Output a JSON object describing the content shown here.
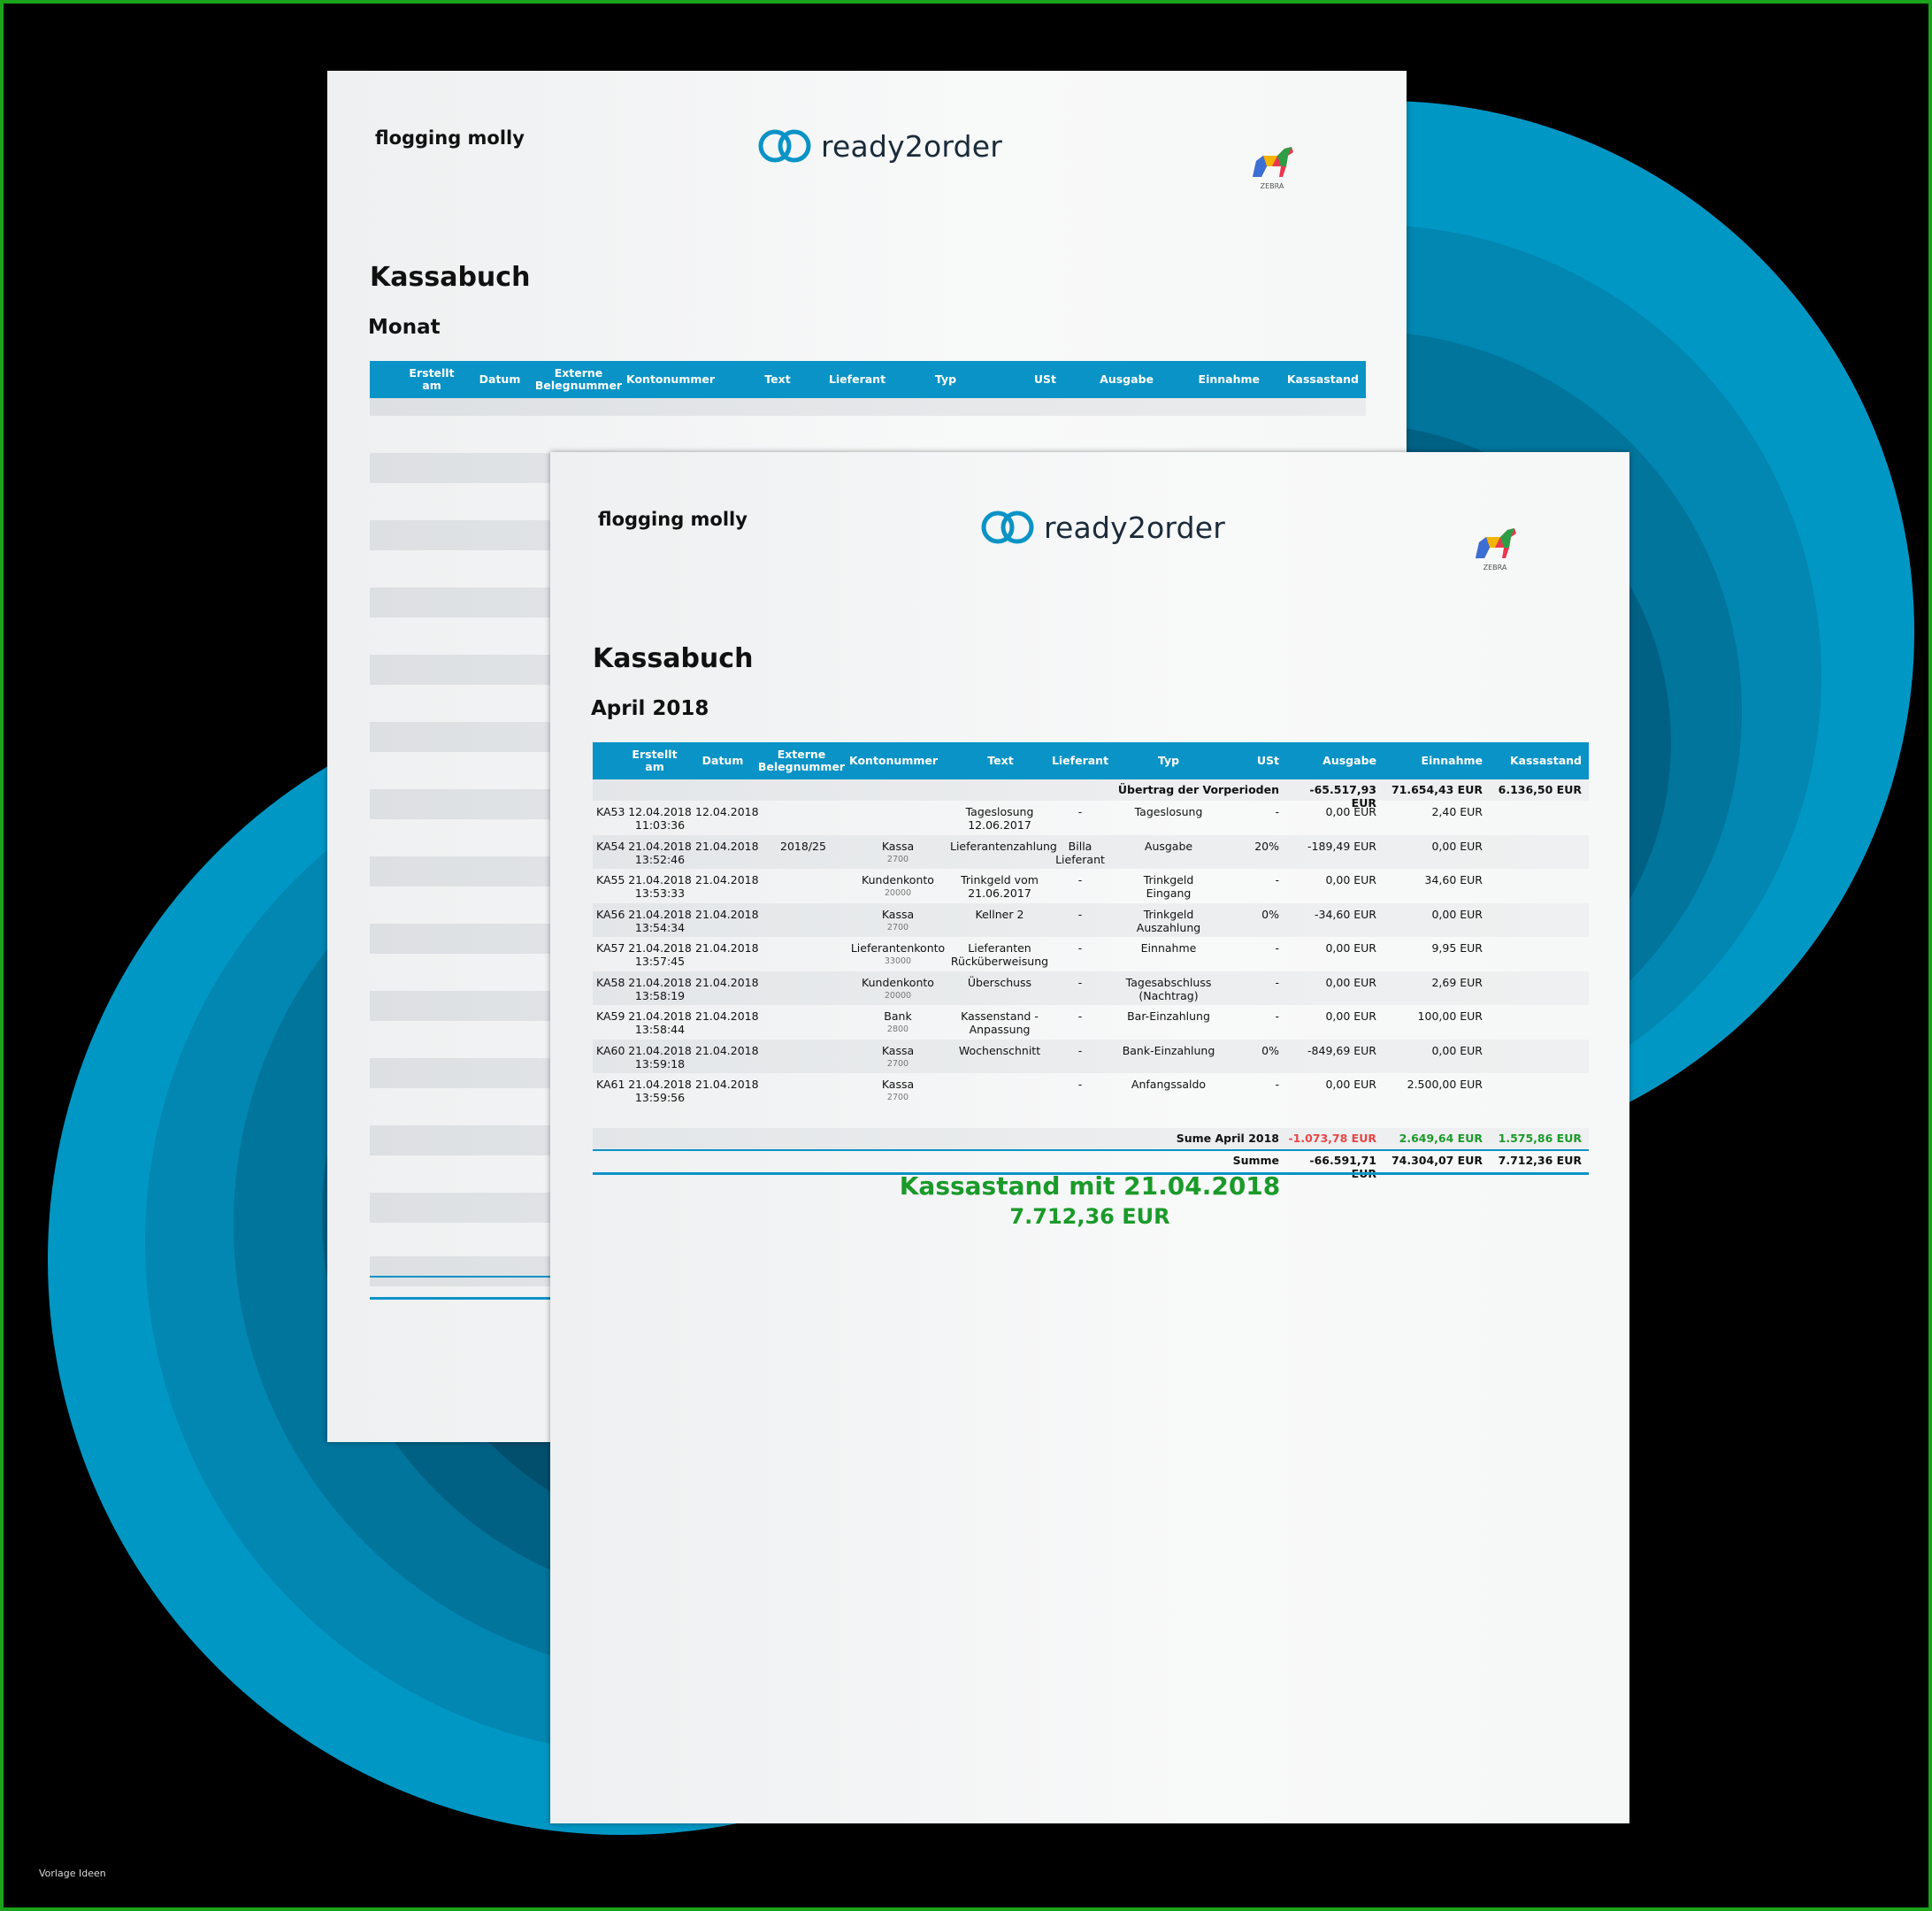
{
  "colors": {
    "accent": "#0a93c6",
    "green": "#1a9a2a",
    "red": "#e84545",
    "frame": "#1aa31a"
  },
  "brand": {
    "name": "ready2order",
    "logo_icon": "ready2order-rings-icon",
    "zebra_label": "ZEBRA"
  },
  "company": "flogging molly",
  "title": "Kassabuch",
  "back_page": {
    "period": "Monat"
  },
  "front_page": {
    "period": "April 2018"
  },
  "columns": {
    "erstellt": "Erstellt am",
    "datum": "Datum",
    "beleg": "Externe Belegnummer",
    "konto": "Kontonummer",
    "text": "Text",
    "lieferant": "Lieferant",
    "typ": "Typ",
    "ust": "USt",
    "ausgabe": "Ausgabe",
    "einnahme": "Einnahme",
    "kassastand": "Kassastand"
  },
  "carryover": {
    "label": "Übertrag der Vorperioden",
    "ausgabe": "-65.517,93 EUR",
    "einnahme": "71.654,43 EUR",
    "kassastand": "6.136,50 EUR"
  },
  "rows": [
    {
      "id": "KA53",
      "created_date": "12.04.2018",
      "created_time": "11:03:36",
      "datum": "12.04.2018",
      "beleg": "",
      "konto": "",
      "konto_nr": "",
      "text": "Tageslosung 12.06.2017",
      "lieferant": "-",
      "typ": "Tageslosung",
      "ust": "-",
      "ausgabe": "0,00 EUR",
      "einnahme": "2,40 EUR"
    },
    {
      "id": "KA54",
      "created_date": "21.04.2018",
      "created_time": "13:52:46",
      "datum": "21.04.2018",
      "beleg": "2018/25",
      "konto": "Kassa",
      "konto_nr": "2700",
      "text": "Lieferantenzahlung",
      "lieferant": "Billa Lieferant",
      "typ": "Ausgabe",
      "ust": "20%",
      "ausgabe": "-189,49 EUR",
      "einnahme": "0,00 EUR"
    },
    {
      "id": "KA55",
      "created_date": "21.04.2018",
      "created_time": "13:53:33",
      "datum": "21.04.2018",
      "beleg": "",
      "konto": "Kundenkonto",
      "konto_nr": "20000",
      "text": "Trinkgeld vom 21.06.2017",
      "lieferant": "-",
      "typ": "Trinkgeld Eingang",
      "ust": "-",
      "ausgabe": "0,00 EUR",
      "einnahme": "34,60 EUR"
    },
    {
      "id": "KA56",
      "created_date": "21.04.2018",
      "created_time": "13:54:34",
      "datum": "21.04.2018",
      "beleg": "",
      "konto": "Kassa",
      "konto_nr": "2700",
      "text": "Kellner 2",
      "lieferant": "-",
      "typ": "Trinkgeld Auszahlung",
      "ust": "0%",
      "ausgabe": "-34,60 EUR",
      "einnahme": "0,00 EUR"
    },
    {
      "id": "KA57",
      "created_date": "21.04.2018",
      "created_time": "13:57:45",
      "datum": "21.04.2018",
      "beleg": "",
      "konto": "Lieferantenkonto",
      "konto_nr": "33000",
      "text": "Lieferanten Rücküberweisung",
      "lieferant": "-",
      "typ": "Einnahme",
      "ust": "-",
      "ausgabe": "0,00 EUR",
      "einnahme": "9,95 EUR"
    },
    {
      "id": "KA58",
      "created_date": "21.04.2018",
      "created_time": "13:58:19",
      "datum": "21.04.2018",
      "beleg": "",
      "konto": "Kundenkonto",
      "konto_nr": "20000",
      "text": "Überschuss",
      "lieferant": "-",
      "typ": "Tagesabschluss (Nachtrag)",
      "ust": "-",
      "ausgabe": "0,00 EUR",
      "einnahme": "2,69 EUR"
    },
    {
      "id": "KA59",
      "created_date": "21.04.2018",
      "created_time": "13:58:44",
      "datum": "21.04.2018",
      "beleg": "",
      "konto": "Bank",
      "konto_nr": "2800",
      "text": "Kassenstand - Anpassung",
      "lieferant": "-",
      "typ": "Bar-Einzahlung",
      "ust": "-",
      "ausgabe": "0,00 EUR",
      "einnahme": "100,00 EUR"
    },
    {
      "id": "KA60",
      "created_date": "21.04.2018",
      "created_time": "13:59:18",
      "datum": "21.04.2018",
      "beleg": "",
      "konto": "Kassa",
      "konto_nr": "2700",
      "text": "Wochenschnitt",
      "lieferant": "-",
      "typ": "Bank-Einzahlung",
      "ust": "0%",
      "ausgabe": "-849,69 EUR",
      "einnahme": "0,00 EUR"
    },
    {
      "id": "KA61",
      "created_date": "21.04.2018",
      "created_time": "13:59:56",
      "datum": "21.04.2018",
      "beleg": "",
      "konto": "Kassa",
      "konto_nr": "2700",
      "text": "",
      "lieferant": "-",
      "typ": "Anfangssaldo",
      "ust": "-",
      "ausgabe": "0,00 EUR",
      "einnahme": "2.500,00 EUR"
    }
  ],
  "month_sum": {
    "label": "Sume April 2018",
    "ausgabe": "-1.073,78 EUR",
    "einnahme": "2.649,64 EUR",
    "kassastand": "1.575,86 EUR"
  },
  "total": {
    "label": "Summe",
    "ausgabe": "-66.591,71 EUR",
    "einnahme": "74.304,07 EUR",
    "kassastand": "7.712,36 EUR"
  },
  "cash_status": {
    "title": "Kassastand mit 21.04.2018",
    "value": "7.712,36 EUR"
  },
  "watermark": "Vorlage Ideen"
}
